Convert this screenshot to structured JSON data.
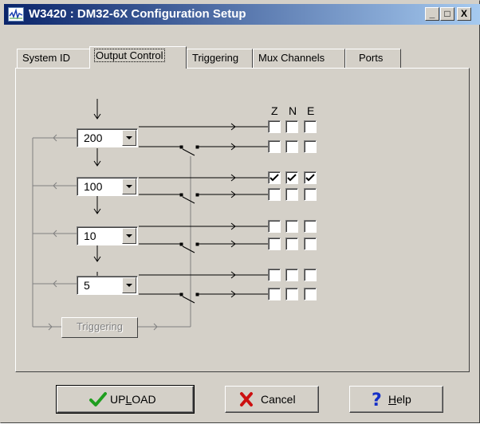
{
  "window": {
    "title": "W3420 : DM32-6X Configuration Setup",
    "buttons": {
      "minimize": "_",
      "maximize": "□",
      "close": "X"
    }
  },
  "tabs": [
    {
      "label": "System ID",
      "active": false
    },
    {
      "label": "Output Control",
      "active": true
    },
    {
      "label": "Triggering",
      "active": false
    },
    {
      "label": "Mux Channels",
      "active": false
    },
    {
      "label": "Ports",
      "active": false
    }
  ],
  "output_control": {
    "column_headers": [
      "Z",
      "N",
      "E"
    ],
    "rates": [
      {
        "value": "200",
        "rows": [
          {
            "z": false,
            "n": false,
            "e": false
          },
          {
            "z": false,
            "n": false,
            "e": false
          }
        ]
      },
      {
        "value": "100",
        "rows": [
          {
            "z": true,
            "n": true,
            "e": true
          },
          {
            "z": false,
            "n": false,
            "e": false
          }
        ]
      },
      {
        "value": "10",
        "rows": [
          {
            "z": false,
            "n": false,
            "e": false
          },
          {
            "z": false,
            "n": false,
            "e": false
          }
        ]
      },
      {
        "value": "5",
        "rows": [
          {
            "z": false,
            "n": false,
            "e": false
          },
          {
            "z": false,
            "n": false,
            "e": false
          }
        ]
      }
    ],
    "triggering_button": "Triggering"
  },
  "footer": {
    "upload": {
      "label_pre": "UP",
      "label_underline": "L",
      "label_post": "OAD",
      "icon": "checkmark-icon",
      "icon_color": "#1f9e1f"
    },
    "cancel": {
      "label": "Cancel",
      "icon": "x-mark-icon",
      "icon_color": "#cc1010"
    },
    "help": {
      "label_underline": "H",
      "label_post": "elp",
      "icon": "question-mark-icon",
      "icon_color": "#1530c8"
    }
  },
  "colors": {
    "face": "#d4d0c8",
    "title_start": "#0a246a",
    "title_end": "#a6caf0"
  }
}
